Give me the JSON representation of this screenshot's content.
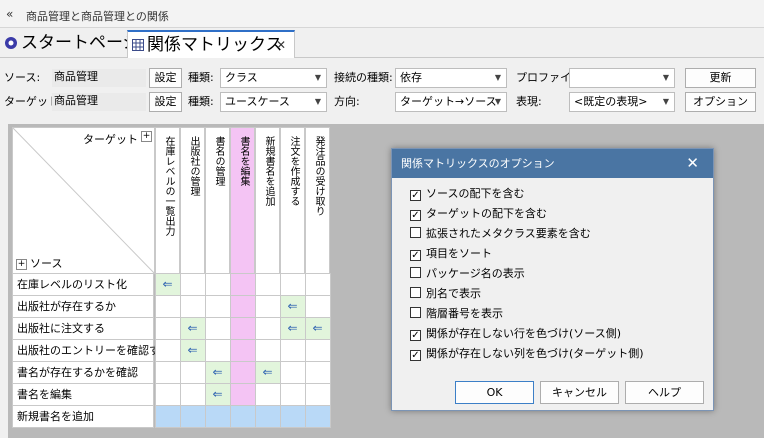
{
  "window": {
    "title": "商品管理と商品管理との関係"
  },
  "tabs": [
    {
      "label": "スタートページ"
    },
    {
      "label": "関係マトリックス"
    }
  ],
  "toolbar": {
    "source_label": "ソース:",
    "source_value": "商品管理",
    "target_label": "ターゲット:",
    "target_value": "商品管理",
    "settings_btn": "設定",
    "type_label": "種類:",
    "source_type": "クラス",
    "target_type": "ユースケース",
    "conn_type_label": "接続の種類:",
    "conn_type": "依存",
    "direction_label": "方向:",
    "direction": "ターゲット→ソース",
    "profile_label": "プロファイル:",
    "profile": "",
    "repr_label": "表現:",
    "repr": "<既定の表現>",
    "update_btn": "更新",
    "options_btn": "オプション"
  },
  "matrix": {
    "target_header": "ターゲット",
    "source_header": "ソース",
    "columns": [
      "在庫レベルの一覧出力",
      "出版社の管理",
      "書名の管理",
      "書名を編集",
      "新規書名を追加",
      "注文を作成する",
      "発注品の受け取り"
    ],
    "rows": [
      "在庫レベルのリスト化",
      "出版社が存在するか",
      "出版社に注文する",
      "出版社のエントリーを確認する",
      "書名が存在するかを確認",
      "書名を編集",
      "新規書名を追加"
    ],
    "relations": [
      [
        0,
        0
      ],
      [
        1,
        5
      ],
      [
        2,
        1
      ],
      [
        2,
        5
      ],
      [
        2,
        6
      ],
      [
        3,
        1
      ],
      [
        4,
        2
      ],
      [
        4,
        4
      ],
      [
        5,
        2
      ]
    ],
    "empty_column_index": 3,
    "empty_row_index": 6,
    "empty_col_color": "#f4c4f4",
    "empty_row_color": "#b9d9f7",
    "relation_cell_color": "#e2f5dc"
  },
  "dialog": {
    "title": "関係マトリックスのオプション",
    "options": [
      {
        "label": "ソースの配下を含む",
        "checked": true
      },
      {
        "label": "ターゲットの配下を含む",
        "checked": true
      },
      {
        "label": "拡張されたメタクラス要素を含む",
        "checked": false
      },
      {
        "label": "項目をソート",
        "checked": true
      },
      {
        "label": "パッケージ名の表示",
        "checked": false
      },
      {
        "label": "別名で表示",
        "checked": false
      },
      {
        "label": "階層番号を表示",
        "checked": false
      },
      {
        "label": "関係が存在しない行を色づけ(ソース側)",
        "checked": true
      },
      {
        "label": "関係が存在しない列を色づけ(ターゲット側)",
        "checked": true
      }
    ],
    "ok": "OK",
    "cancel": "キャンセル",
    "help": "ヘルプ"
  }
}
